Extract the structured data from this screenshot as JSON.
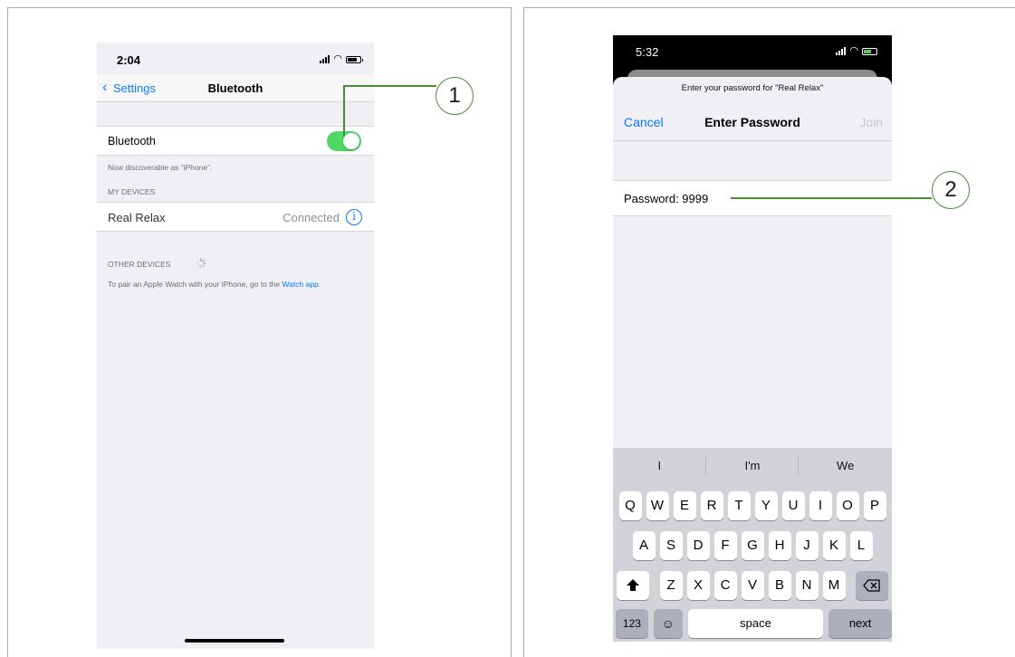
{
  "left_phone": {
    "status_time": "2:04",
    "back_label": "Settings",
    "nav_title": "Bluetooth",
    "bluetooth_label": "Bluetooth",
    "bluetooth_on": true,
    "discoverable_text": "Now discoverable as “iPhone”.",
    "my_devices_header": "MY DEVICES",
    "device_name": "Real Relax",
    "device_status": "Connected",
    "other_devices_header": "OTHER DEVICES",
    "pair_text": "To pair an Apple Watch with your iPhone, go to the ",
    "pair_link": "Watch app",
    "pair_end": "."
  },
  "right_phone": {
    "status_time": "5:32",
    "prompt": "Enter your password for \"Real Relax\"",
    "cancel_label": "Cancel",
    "nav_title": "Enter Password",
    "join_label": "Join",
    "password_text": "Password: 9999",
    "suggestions": [
      "I",
      "I'm",
      "We"
    ],
    "row1": [
      "Q",
      "W",
      "E",
      "R",
      "T",
      "Y",
      "U",
      "I",
      "O",
      "P"
    ],
    "row2": [
      "A",
      "S",
      "D",
      "F",
      "G",
      "H",
      "J",
      "K",
      "L"
    ],
    "row3": [
      "Z",
      "X",
      "C",
      "V",
      "B",
      "N",
      "M"
    ],
    "num_key": "123",
    "space_key": "space",
    "next_key": "next"
  },
  "callouts": {
    "one": "1",
    "two": "2"
  },
  "colors": {
    "toggle_on": "#4cd964",
    "link_blue": "#0a7aff",
    "callout_green": "#4b8b3b"
  }
}
